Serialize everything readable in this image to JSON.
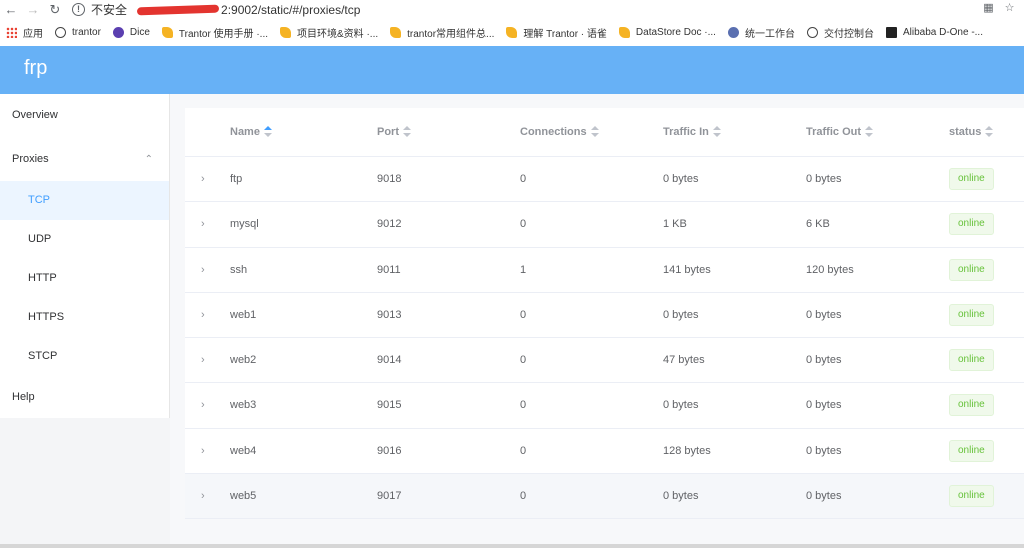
{
  "browser": {
    "insecure_label": "不安全",
    "url_suffix": "2:9002/static/#/proxies/tcp",
    "bookmarks": [
      {
        "label": "应用",
        "icon": "apps-grid-icon"
      },
      {
        "label": "trantor",
        "icon": "globe-icon"
      },
      {
        "label": "Dice",
        "icon": "dice-icon"
      },
      {
        "label": "Trantor 使用手册 ·...",
        "icon": "yuque-icon"
      },
      {
        "label": "项目环境&资料 ·...",
        "icon": "yuque-icon"
      },
      {
        "label": "trantor常用组件总...",
        "icon": "yuque-icon"
      },
      {
        "label": "理解 Trantor · 语雀",
        "icon": "yuque-icon"
      },
      {
        "label": "DataStore Doc ·...",
        "icon": "yuque-icon"
      },
      {
        "label": "统一工作台",
        "icon": "workbench-icon"
      },
      {
        "label": "交付控制台",
        "icon": "globe-icon"
      },
      {
        "label": "Alibaba D-One -...",
        "icon": "done-icon"
      }
    ]
  },
  "app": {
    "title": "frp"
  },
  "sidebar": {
    "items": [
      {
        "label": "Overview"
      },
      {
        "label": "Proxies"
      },
      {
        "label": "TCP"
      },
      {
        "label": "UDP"
      },
      {
        "label": "HTTP"
      },
      {
        "label": "HTTPS"
      },
      {
        "label": "STCP"
      },
      {
        "label": "Help"
      }
    ],
    "active": "TCP"
  },
  "table": {
    "columns": [
      "Name",
      "Port",
      "Connections",
      "Traffic In",
      "Traffic Out",
      "status"
    ],
    "sorted_column": "Name",
    "rows": [
      {
        "name": "ftp",
        "port": "9018",
        "connections": "0",
        "traffic_in": "0 bytes",
        "traffic_out": "0 bytes",
        "status": "online"
      },
      {
        "name": "mysql",
        "port": "9012",
        "connections": "0",
        "traffic_in": "1 KB",
        "traffic_out": "6 KB",
        "status": "online"
      },
      {
        "name": "ssh",
        "port": "9011",
        "connections": "1",
        "traffic_in": "141 bytes",
        "traffic_out": "120 bytes",
        "status": "online"
      },
      {
        "name": "web1",
        "port": "9013",
        "connections": "0",
        "traffic_in": "0 bytes",
        "traffic_out": "0 bytes",
        "status": "online"
      },
      {
        "name": "web2",
        "port": "9014",
        "connections": "0",
        "traffic_in": "47 bytes",
        "traffic_out": "0 bytes",
        "status": "online"
      },
      {
        "name": "web3",
        "port": "9015",
        "connections": "0",
        "traffic_in": "0 bytes",
        "traffic_out": "0 bytes",
        "status": "online"
      },
      {
        "name": "web4",
        "port": "9016",
        "connections": "0",
        "traffic_in": "128 bytes",
        "traffic_out": "0 bytes",
        "status": "online"
      },
      {
        "name": "web5",
        "port": "9017",
        "connections": "0",
        "traffic_in": "0 bytes",
        "traffic_out": "0 bytes",
        "status": "online"
      }
    ]
  },
  "colors": {
    "header": "#67b1f6",
    "active_text": "#409eff",
    "active_bg": "#ecf5ff",
    "online_text": "#67c23a",
    "online_bg": "#f0f9eb"
  }
}
